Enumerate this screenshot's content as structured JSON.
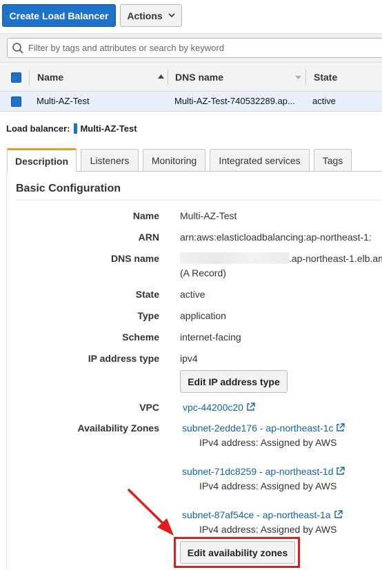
{
  "toolbar": {
    "create_label": "Create Load Balancer",
    "actions_label": "Actions"
  },
  "filter": {
    "placeholder": "Filter by tags and attributes or search by keyword"
  },
  "table": {
    "columns": [
      "Name",
      "DNS name",
      "State"
    ],
    "rows": [
      {
        "name": "Multi-AZ-Test",
        "dns": "Multi-AZ-Test-740532289.ap...",
        "state": "active"
      }
    ]
  },
  "detail": {
    "header_label": "Load balancer:",
    "header_value": "Multi-AZ-Test",
    "tabs": [
      "Description",
      "Listeners",
      "Monitoring",
      "Integrated services",
      "Tags"
    ],
    "section_title": "Basic Configuration",
    "fields": {
      "name": {
        "label": "Name",
        "value": "Multi-AZ-Test"
      },
      "arn": {
        "label": "ARN",
        "value": "arn:aws:elasticloadbalancing:ap-northeast-1:"
      },
      "dns": {
        "label": "DNS name",
        "value": ".ap-northeast-1.elb.am",
        "record": "(A Record)"
      },
      "state": {
        "label": "State",
        "value": "active"
      },
      "type": {
        "label": "Type",
        "value": "application"
      },
      "scheme": {
        "label": "Scheme",
        "value": "internet-facing"
      },
      "ip_type": {
        "label": "IP address type",
        "value": "ipv4"
      },
      "vpc": {
        "label": "VPC",
        "value": "vpc-44200c20"
      },
      "azs": {
        "label": "Availability Zones"
      }
    },
    "edit_ip_label": "Edit IP address type",
    "subnets": [
      {
        "name": "subnet-2edde176 - ap-northeast-1c",
        "ipv4": "IPv4 address: Assigned by AWS"
      },
      {
        "name": "subnet-71dc8259 - ap-northeast-1d",
        "ipv4": "IPv4 address: Assigned by AWS"
      },
      {
        "name": "subnet-87af54ce - ap-northeast-1a",
        "ipv4": "IPv4 address: Assigned by AWS"
      }
    ],
    "edit_az_label": "Edit availability zones"
  },
  "colors": {
    "primary": "#1f72c9",
    "link": "#0e64b0",
    "tab_accent": "#ec9c1b",
    "annotation": "#e51c1c"
  }
}
